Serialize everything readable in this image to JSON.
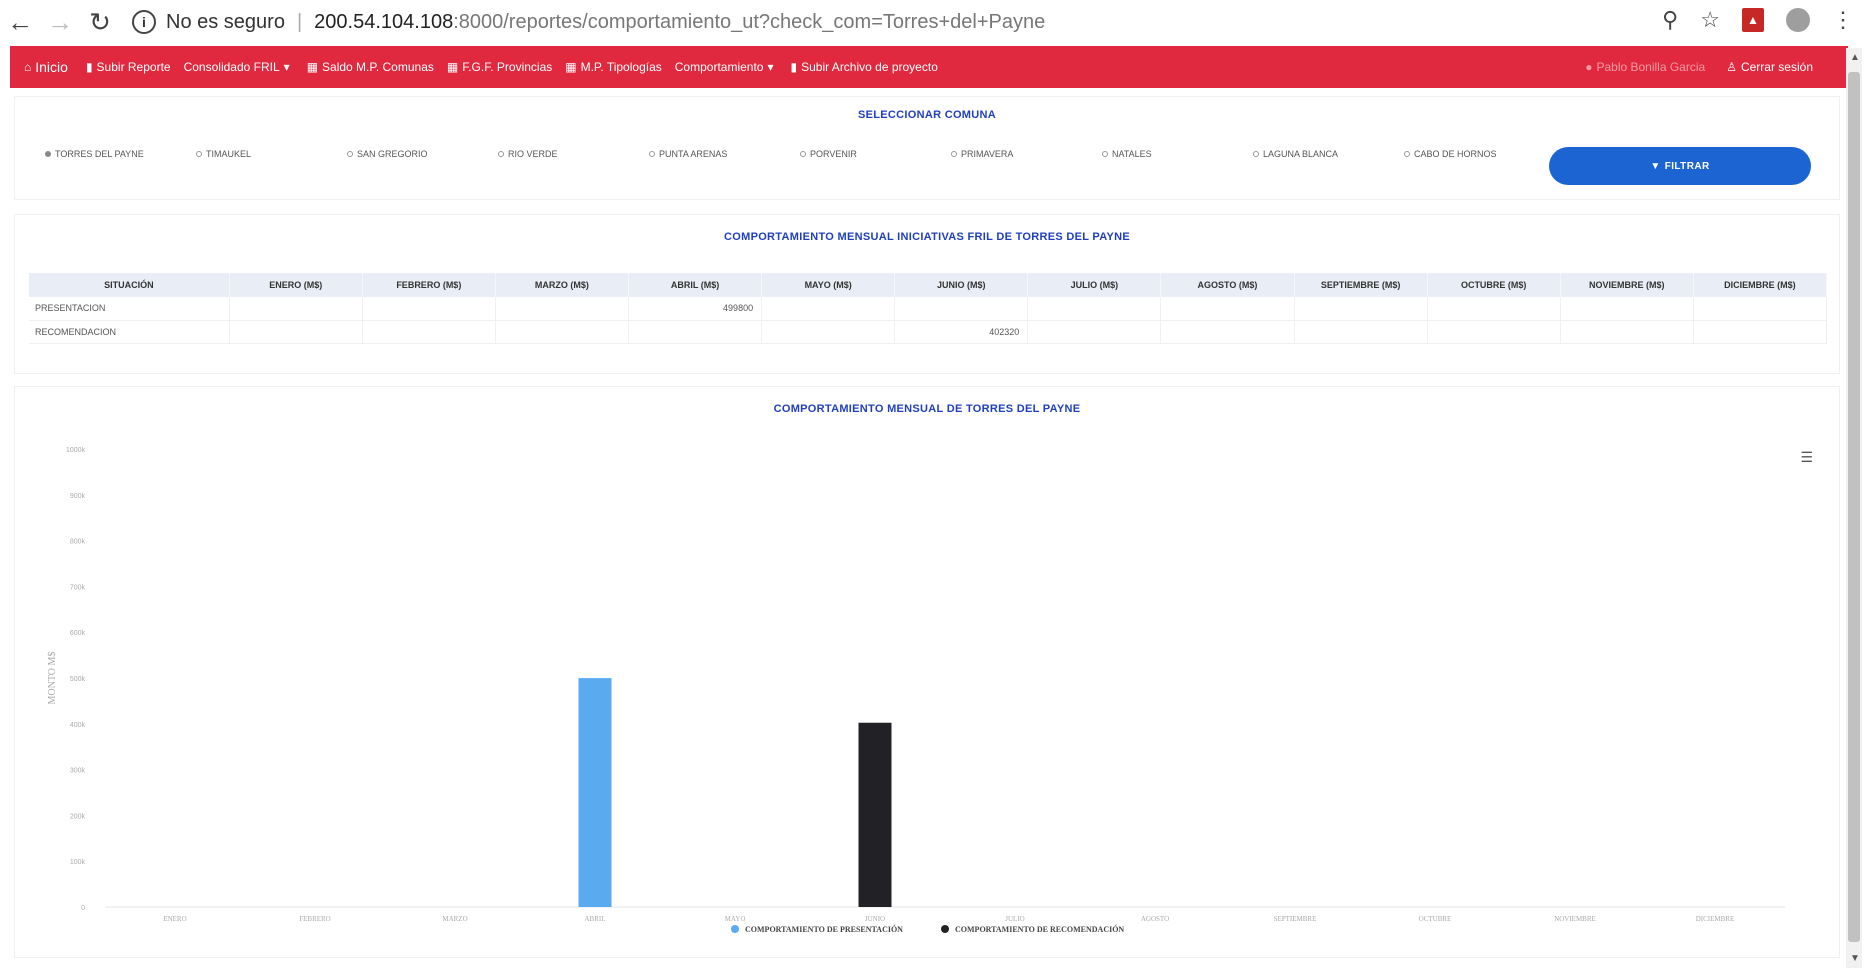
{
  "browser": {
    "back_icon": "back-arrow-icon",
    "forward_icon": "forward-arrow-icon",
    "reload_icon": "reload-icon",
    "security_text": "No es seguro",
    "url_host": "200.54.104.108",
    "url_path": ":8000/reportes/comportamiento_ut?check_com=Torres+del+Payne"
  },
  "navbar": {
    "home": "Inicio",
    "items": [
      {
        "label": "Subir Reporte"
      },
      {
        "label": "Consolidado FRIL"
      },
      {
        "label": "Saldo M.P. Comunas"
      },
      {
        "label": "F.G.F. Provincias"
      },
      {
        "label": "M.P. Tipologías"
      },
      {
        "label": "Comportamiento"
      },
      {
        "label": "Subir Archivo de proyecto"
      }
    ],
    "user": "Pablo Bonilla Garcia",
    "logout": "Cerrar sesión",
    "color": "#e0283e"
  },
  "comunas": {
    "title": "SELECCIONAR COMUNA",
    "options": [
      {
        "label": "TORRES DEL PAYNE",
        "checked": true
      },
      {
        "label": "TIMAUKEL",
        "checked": false
      },
      {
        "label": "SAN GREGORIO",
        "checked": false
      },
      {
        "label": "RIO VERDE",
        "checked": false
      },
      {
        "label": "PUNTA ARENAS",
        "checked": false
      },
      {
        "label": "PORVENIR",
        "checked": false
      },
      {
        "label": "PRIMAVERA",
        "checked": false
      },
      {
        "label": "NATALES",
        "checked": false
      },
      {
        "label": "LAGUNA BLANCA",
        "checked": false
      },
      {
        "label": "CABO DE HORNOS",
        "checked": false
      }
    ],
    "filter_label": "FILTRAR"
  },
  "table": {
    "title": "COMPORTAMIENTO MENSUAL INICIATIVAS FRIL DE TORRES DEL PAYNE",
    "headers": [
      "SITUACIÓN",
      "ENERO (M$)",
      "FEBRERO (M$)",
      "MARZO (M$)",
      "ABRIL (M$)",
      "MAYO (M$)",
      "JUNIO (M$)",
      "JULIO (M$)",
      "AGOSTO (M$)",
      "SEPTIEMBRE (M$)",
      "OCTUBRE (M$)",
      "NOVIEMBRE (M$)",
      "DICIEMBRE (M$)"
    ],
    "rows": [
      [
        "PRESENTACION",
        "",
        "",
        "",
        "499800",
        "",
        "",
        "",
        "",
        "",
        "",
        "",
        ""
      ],
      [
        "RECOMENDACION",
        "",
        "",
        "",
        "",
        "",
        "402320",
        "",
        "",
        "",
        "",
        "",
        ""
      ]
    ]
  },
  "chart_data": {
    "type": "bar",
    "title": "COMPORTAMIENTO MENSUAL DE TORRES DEL PAYNE",
    "ylabel": "MONTO M$",
    "xlabel": "",
    "categories": [
      "ENERO",
      "FEBRERO",
      "MARZO",
      "ABRIL",
      "MAYO",
      "JUNIO",
      "JULIO",
      "AGOSTO",
      "SEPTIEMBRE",
      "OCTUBRE",
      "NOVIEMBRE",
      "DICIEMBRE"
    ],
    "ylim": [
      0,
      1000000
    ],
    "yticks": [
      "0",
      "100k",
      "200k",
      "300k",
      "400k",
      "500k",
      "600k",
      "700k",
      "800k",
      "900k",
      "1000k"
    ],
    "series": [
      {
        "name": "COMPORTAMIENTO DE PRESENTACIÓN",
        "color": "#5aaaf0",
        "values": [
          0,
          0,
          0,
          499800,
          0,
          0,
          0,
          0,
          0,
          0,
          0,
          0
        ]
      },
      {
        "name": "COMPORTAMIENTO DE RECOMENDACIÓN",
        "color": "#222226",
        "values": [
          0,
          0,
          0,
          0,
          0,
          402320,
          0,
          0,
          0,
          0,
          0,
          0
        ]
      }
    ],
    "legend": "bottom-center",
    "grid": false
  }
}
